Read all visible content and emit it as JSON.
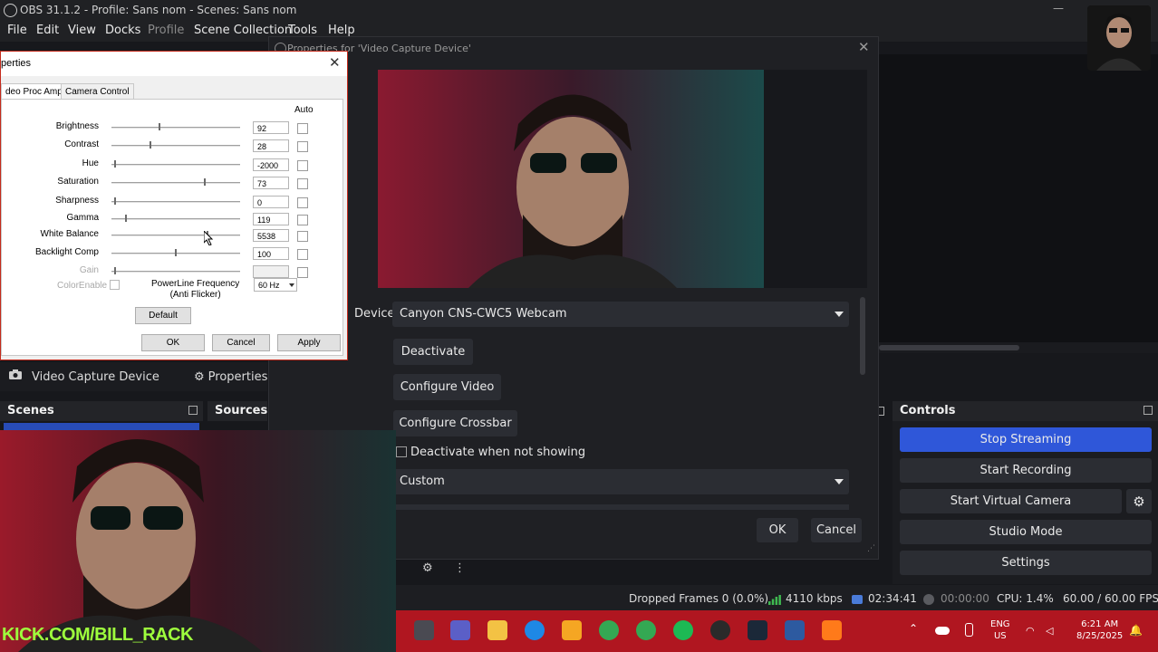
{
  "window": {
    "title": "OBS 31.1.2 - Profile: Sans nom - Scenes: Sans nom"
  },
  "menu": [
    {
      "label": "File",
      "disabled": false
    },
    {
      "label": "Edit",
      "disabled": false
    },
    {
      "label": "View",
      "disabled": false
    },
    {
      "label": "Docks",
      "disabled": false
    },
    {
      "label": "Profile",
      "disabled": true
    },
    {
      "label": "Scene Collection",
      "disabled": false
    },
    {
      "label": "Tools",
      "disabled": false
    },
    {
      "label": "Help",
      "disabled": false
    }
  ],
  "source_toolbar": {
    "source_name": "Video Capture Device",
    "properties_label": "Properties"
  },
  "docks": {
    "scenes": "Scenes",
    "sources": "Sources",
    "controls": "Controls"
  },
  "controls": {
    "stop_streaming": "Stop Streaming",
    "start_recording": "Start Recording",
    "start_virtual_camera": "Start Virtual Camera",
    "studio_mode": "Studio Mode",
    "settings": "Settings"
  },
  "status": {
    "dropped_frames": "Dropped Frames 0 (0.0%)",
    "bitrate": "4110 kbps",
    "stream_time": "02:34:41",
    "rec_time": "00:00:00",
    "cpu": "CPU: 1.4%",
    "fps": "60.00 / 60.00 FPS"
  },
  "vcd_dialog": {
    "title": "Properties for 'Video Capture Device'",
    "device_label": "Device",
    "device_value": "Canyon CNS-CWC5 Webcam",
    "deactivate": "Deactivate",
    "configure_video": "Configure Video",
    "configure_crossbar": "Configure Crossbar",
    "deactivate_when_not_showing": "Deactivate when not showing",
    "resolution_type": "Custom",
    "ok": "OK",
    "cancel": "Cancel"
  },
  "amp_dialog": {
    "title": "perties",
    "tab_video_proc_amp": "deo Proc Amp",
    "tab_camera_control": "Camera Control",
    "auto_header": "Auto",
    "rows": [
      {
        "label": "Brightness",
        "value": "92",
        "level": 0.37,
        "disabled": false
      },
      {
        "label": "Contrast",
        "value": "28",
        "level": 0.3,
        "disabled": false
      },
      {
        "label": "Hue",
        "value": "-2000",
        "level": 0.02,
        "disabled": false
      },
      {
        "label": "Saturation",
        "value": "73",
        "level": 0.73,
        "disabled": false
      },
      {
        "label": "Sharpness",
        "value": "0",
        "level": 0.02,
        "disabled": false
      },
      {
        "label": "Gamma",
        "value": "119",
        "level": 0.11,
        "disabled": false
      },
      {
        "label": "White Balance",
        "value": "5538",
        "level": 0.75,
        "disabled": false
      },
      {
        "label": "Backlight Comp",
        "value": "100",
        "level": 0.5,
        "disabled": false
      },
      {
        "label": "Gain",
        "value": "",
        "level": 0.02,
        "disabled": true
      }
    ],
    "color_enable": "ColorEnable",
    "powerline_label_1": "PowerLine Frequency",
    "powerline_label_2": "(Anti Flicker)",
    "powerline_value": "60 Hz",
    "default": "Default",
    "ok": "OK",
    "cancel": "Cancel",
    "apply": "Apply"
  },
  "overlay": {
    "kick_text": "KICK.COM/BILL_RACK"
  },
  "taskbar": {
    "lang_1": "ENG",
    "lang_2": "US",
    "time": "6:21 AM",
    "date": "8/25/2025"
  },
  "colors": {
    "accent": "#2f57d9",
    "taskbar": "#b01620",
    "dialog_border": "#c42b1c",
    "overlay_text": "#9eff3d"
  }
}
